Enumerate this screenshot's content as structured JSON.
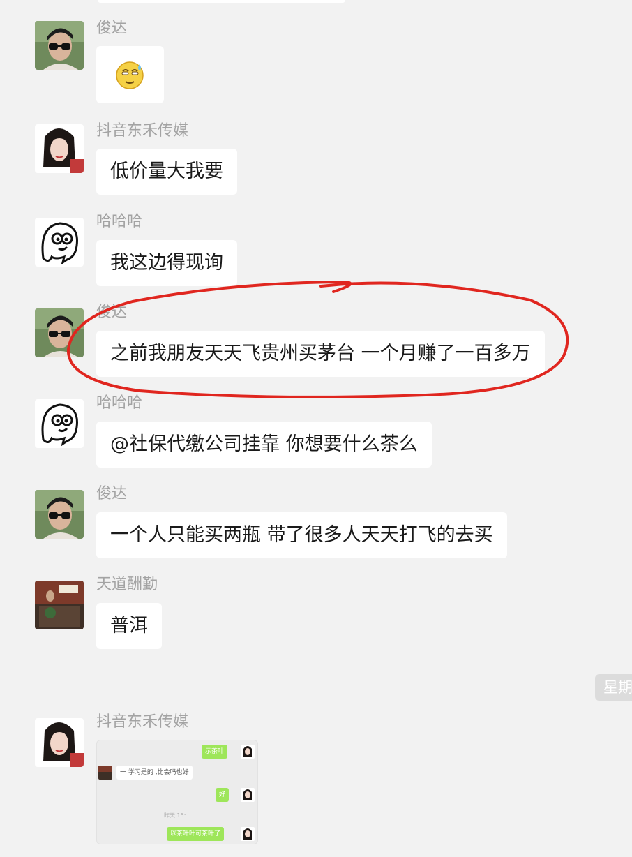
{
  "messages": [
    {
      "sender": "俊达",
      "type": "emoji",
      "emoji": "sweat-smile-emoji"
    },
    {
      "sender": "抖音东禾传媒",
      "text": "低价量大我要"
    },
    {
      "sender": "哈哈哈",
      "text": "我这边得现询"
    },
    {
      "sender": "俊达",
      "text": "之前我朋友天天飞贵州买茅台 一个月赚了一百多万"
    },
    {
      "sender": "哈哈哈",
      "text": "@社保代缴公司挂靠 你想要什么茶么"
    },
    {
      "sender": "俊达",
      "text": "一个人只能买两瓶 带了很多人天天打飞的去买"
    },
    {
      "sender": "天道酬勤",
      "text": "普洱"
    },
    {
      "sender": "抖音东禾传媒",
      "type": "screenshot"
    }
  ],
  "time_badge": "星期",
  "screenshot_preview": {
    "lines": [
      "示茶叶",
      "一 学习是的 ,比会吗也好",
      "好",
      "昨天 15:",
      "以茶叶叶可茶叶了"
    ]
  },
  "colors": {
    "background": "#f2f2f2",
    "bubble": "#ffffff",
    "highlight": "#e0261f",
    "sender_text": "#a3a3a3"
  }
}
